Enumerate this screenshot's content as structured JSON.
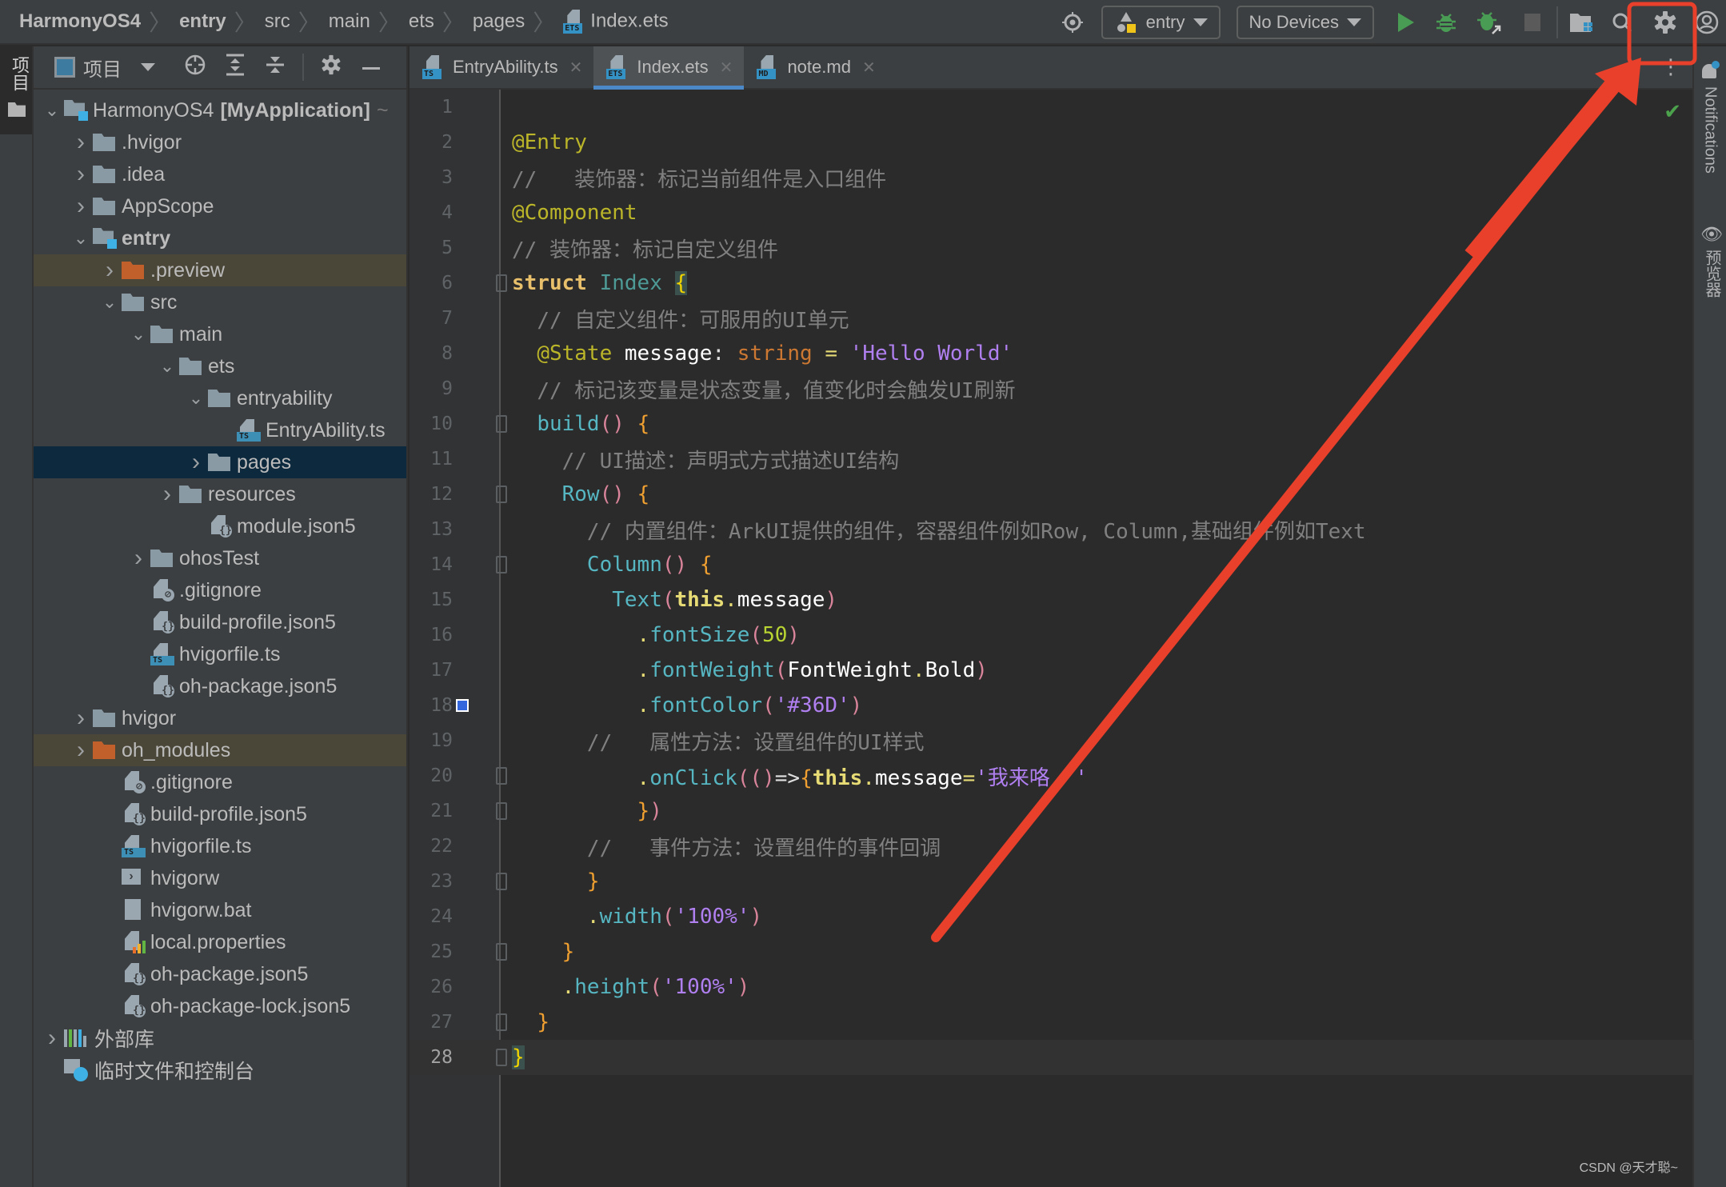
{
  "breadcrumb": {
    "items": [
      "HarmonyOS4",
      "entry",
      "src",
      "main",
      "ets",
      "pages"
    ],
    "file": "Index.ets",
    "file_badge": "ETS"
  },
  "toolbar": {
    "target_icon": "locate-icon",
    "module_selector": "entry",
    "device_selector": "No Devices",
    "run": "run-icon",
    "debug": "debug-icon",
    "attach_debug": "attach-debugger-icon",
    "stop": "stop-icon",
    "project_structure": "project-structure-icon",
    "search": "search-icon",
    "settings": "settings-icon",
    "account": "account-icon"
  },
  "left_strip": {
    "project_tab_label": "项目"
  },
  "project_panel": {
    "title": "项目",
    "tree": [
      {
        "label": "HarmonyOS4",
        "suffix": "[MyApplication]",
        "tail": "~",
        "depth": 0,
        "chevron": "down",
        "icon": "module-folder"
      },
      {
        "label": ".hvigor",
        "depth": 1,
        "chevron": "right",
        "icon": "folder"
      },
      {
        "label": ".idea",
        "depth": 1,
        "chevron": "right",
        "icon": "folder"
      },
      {
        "label": "AppScope",
        "depth": 1,
        "chevron": "right",
        "icon": "folder"
      },
      {
        "label": "entry",
        "depth": 1,
        "chevron": "down",
        "icon": "module-folder",
        "bold": true
      },
      {
        "label": ".preview",
        "depth": 2,
        "chevron": "right",
        "icon": "folder-orange",
        "state": "excluded"
      },
      {
        "label": "src",
        "depth": 2,
        "chevron": "down",
        "icon": "folder"
      },
      {
        "label": "main",
        "depth": 3,
        "chevron": "down",
        "icon": "folder"
      },
      {
        "label": "ets",
        "depth": 4,
        "chevron": "down",
        "icon": "folder"
      },
      {
        "label": "entryability",
        "depth": 5,
        "chevron": "down",
        "icon": "folder"
      },
      {
        "label": "EntryAbility.ts",
        "depth": 6,
        "chevron": "none",
        "icon": "ts-file"
      },
      {
        "label": "pages",
        "depth": 5,
        "chevron": "right",
        "icon": "folder",
        "state": "selected"
      },
      {
        "label": "resources",
        "depth": 4,
        "chevron": "right",
        "icon": "folder"
      },
      {
        "label": "module.json5",
        "depth": 5,
        "chevron": "none",
        "icon": "json-file"
      },
      {
        "label": "ohosTest",
        "depth": 3,
        "chevron": "right",
        "icon": "folder"
      },
      {
        "label": ".gitignore",
        "depth": 3,
        "chevron": "none",
        "icon": "ignore-file"
      },
      {
        "label": "build-profile.json5",
        "depth": 3,
        "chevron": "none",
        "icon": "json-file"
      },
      {
        "label": "hvigorfile.ts",
        "depth": 3,
        "chevron": "none",
        "icon": "ts-file"
      },
      {
        "label": "oh-package.json5",
        "depth": 3,
        "chevron": "none",
        "icon": "json-file"
      },
      {
        "label": "hvigor",
        "depth": 1,
        "chevron": "right",
        "icon": "folder"
      },
      {
        "label": "oh_modules",
        "depth": 1,
        "chevron": "right",
        "icon": "folder-orange",
        "state": "excluded"
      },
      {
        "label": ".gitignore",
        "depth": 2,
        "chevron": "none",
        "icon": "ignore-file"
      },
      {
        "label": "build-profile.json5",
        "depth": 2,
        "chevron": "none",
        "icon": "json-file"
      },
      {
        "label": "hvigorfile.ts",
        "depth": 2,
        "chevron": "none",
        "icon": "ts-file"
      },
      {
        "label": "hvigorw",
        "depth": 2,
        "chevron": "none",
        "icon": "shell-file"
      },
      {
        "label": "hvigorw.bat",
        "depth": 2,
        "chevron": "none",
        "icon": "text-file"
      },
      {
        "label": "local.properties",
        "depth": 2,
        "chevron": "none",
        "icon": "properties-file"
      },
      {
        "label": "oh-package.json5",
        "depth": 2,
        "chevron": "none",
        "icon": "json-file"
      },
      {
        "label": "oh-package-lock.json5",
        "depth": 2,
        "chevron": "none",
        "icon": "json-file"
      },
      {
        "label": "外部库",
        "depth": 0,
        "chevron": "right",
        "icon": "library"
      },
      {
        "label": "临时文件和控制台",
        "depth": 0,
        "chevron": "none",
        "icon": "scratch"
      }
    ]
  },
  "editor_tabs": [
    {
      "label": "EntryAbility.ts",
      "badge": "TS",
      "active": false
    },
    {
      "label": "Index.ets",
      "badge": "ETS",
      "active": true
    },
    {
      "label": "note.md",
      "badge": "MD",
      "active": false
    }
  ],
  "editor": {
    "current_line": 28,
    "lines": [
      [],
      [
        [
          "t-ann",
          "@Entry"
        ]
      ],
      [
        [
          "t-cmt",
          "//   装饰器：标记当前组件是入口组件"
        ]
      ],
      [
        [
          "t-ann",
          "@Component"
        ]
      ],
      [
        [
          "t-cmt",
          "// 装饰器：标记自定义组件"
        ]
      ],
      [
        [
          "t-kw",
          "struct"
        ],
        [
          "t-plain",
          " "
        ],
        [
          "t-type",
          "Index"
        ],
        [
          "t-plain",
          " "
        ],
        [
          "t-brace brace-hl",
          "{"
        ]
      ],
      [
        [
          "t-plain",
          "  "
        ],
        [
          "t-cmt",
          "// 自定义组件：可服用的UI单元"
        ]
      ],
      [
        [
          "t-plain",
          "  "
        ],
        [
          "t-ann",
          "@State"
        ],
        [
          "t-plain",
          " "
        ],
        [
          "t-var",
          "message"
        ],
        [
          "t-plain",
          ": "
        ],
        [
          "t-typeo",
          "string"
        ],
        [
          "t-plain",
          " "
        ],
        [
          "t-dot",
          "="
        ],
        [
          "t-plain",
          " "
        ],
        [
          "t-str",
          "'Hello World'"
        ]
      ],
      [
        [
          "t-plain",
          "  "
        ],
        [
          "t-cmt",
          "// 标记该变量是状态变量，值变化时会触发UI刷新"
        ]
      ],
      [
        [
          "t-plain",
          "  "
        ],
        [
          "t-fn",
          "build"
        ],
        [
          "t-paren",
          "()"
        ],
        [
          "t-plain",
          " "
        ],
        [
          "t-ob",
          "{"
        ]
      ],
      [
        [
          "t-plain",
          "    "
        ],
        [
          "t-cmt",
          "// UI描述：声明式方式描述UI结构"
        ]
      ],
      [
        [
          "t-plain",
          "    "
        ],
        [
          "t-fn",
          "Row"
        ],
        [
          "t-paren",
          "()"
        ],
        [
          "t-plain",
          " "
        ],
        [
          "t-ob",
          "{"
        ]
      ],
      [
        [
          "t-plain",
          "      "
        ],
        [
          "t-cmt",
          "// 内置组件：ArkUI提供的组件，容器组件例如Row, Column,基础组件例如Text"
        ]
      ],
      [
        [
          "t-plain",
          "      "
        ],
        [
          "t-fn",
          "Column"
        ],
        [
          "t-paren",
          "()"
        ],
        [
          "t-plain",
          " "
        ],
        [
          "t-ob",
          "{"
        ]
      ],
      [
        [
          "t-plain",
          "        "
        ],
        [
          "t-fn",
          "Text"
        ],
        [
          "t-paren",
          "("
        ],
        [
          "t-this",
          "this"
        ],
        [
          "t-dot",
          "."
        ],
        [
          "t-var",
          "message"
        ],
        [
          "t-paren",
          ")"
        ]
      ],
      [
        [
          "t-plain",
          "          "
        ],
        [
          "t-dot",
          "."
        ],
        [
          "t-fn",
          "fontSize"
        ],
        [
          "t-paren",
          "("
        ],
        [
          "t-num",
          "50"
        ],
        [
          "t-paren",
          ")"
        ]
      ],
      [
        [
          "t-plain",
          "          "
        ],
        [
          "t-dot",
          "."
        ],
        [
          "t-fn",
          "fontWeight"
        ],
        [
          "t-paren",
          "("
        ],
        [
          "t-var",
          "FontWeight"
        ],
        [
          "t-dot",
          "."
        ],
        [
          "t-var",
          "Bold"
        ],
        [
          "t-paren",
          ")"
        ]
      ],
      [
        [
          "t-plain",
          "          "
        ],
        [
          "t-dot",
          "."
        ],
        [
          "t-fn",
          "fontColor"
        ],
        [
          "t-paren",
          "("
        ],
        [
          "t-str",
          "'#36D'"
        ],
        [
          "t-paren",
          ")"
        ]
      ],
      [
        [
          "t-plain",
          "      "
        ],
        [
          "t-cmt",
          "//   属性方法：设置组件的UI样式"
        ]
      ],
      [
        [
          "t-plain",
          "          "
        ],
        [
          "t-dot",
          "."
        ],
        [
          "t-fn",
          "onClick"
        ],
        [
          "t-paren",
          "(()"
        ],
        [
          "t-plain",
          "=>"
        ],
        [
          "t-ob",
          "{"
        ],
        [
          "t-this",
          "this"
        ],
        [
          "t-dot",
          "."
        ],
        [
          "t-var",
          "message"
        ],
        [
          "t-dot",
          "="
        ],
        [
          "t-str",
          "'我来咯  '"
        ]
      ],
      [
        [
          "t-plain",
          "          "
        ],
        [
          "t-ob",
          "}"
        ],
        [
          "t-paren",
          ")"
        ]
      ],
      [
        [
          "t-plain",
          "      "
        ],
        [
          "t-cmt",
          "//   事件方法：设置组件的事件回调"
        ]
      ],
      [
        [
          "t-plain",
          "      "
        ],
        [
          "t-ob",
          "}"
        ]
      ],
      [
        [
          "t-plain",
          "      "
        ],
        [
          "t-dot",
          "."
        ],
        [
          "t-fn",
          "width"
        ],
        [
          "t-paren",
          "("
        ],
        [
          "t-str",
          "'100%'"
        ],
        [
          "t-paren",
          ")"
        ]
      ],
      [
        [
          "t-plain",
          "    "
        ],
        [
          "t-ob",
          "}"
        ]
      ],
      [
        [
          "t-plain",
          "    "
        ],
        [
          "t-dot",
          "."
        ],
        [
          "t-fn",
          "height"
        ],
        [
          "t-paren",
          "("
        ],
        [
          "t-str",
          "'100%'"
        ],
        [
          "t-paren",
          ")"
        ]
      ],
      [
        [
          "t-plain",
          "  "
        ],
        [
          "t-ob",
          "}"
        ]
      ],
      [
        [
          "t-brace brace-hl",
          "}"
        ]
      ]
    ],
    "color_swatch_line": 18,
    "color_swatch_value": "#3366DD",
    "inspection_status": "no-problems"
  },
  "right_strip": {
    "notifications": "Notifications",
    "previewer": "预览器"
  },
  "annotation": {
    "color": "#E8402A",
    "target": "settings-button"
  },
  "watermark": "CSDN @天才聪~"
}
